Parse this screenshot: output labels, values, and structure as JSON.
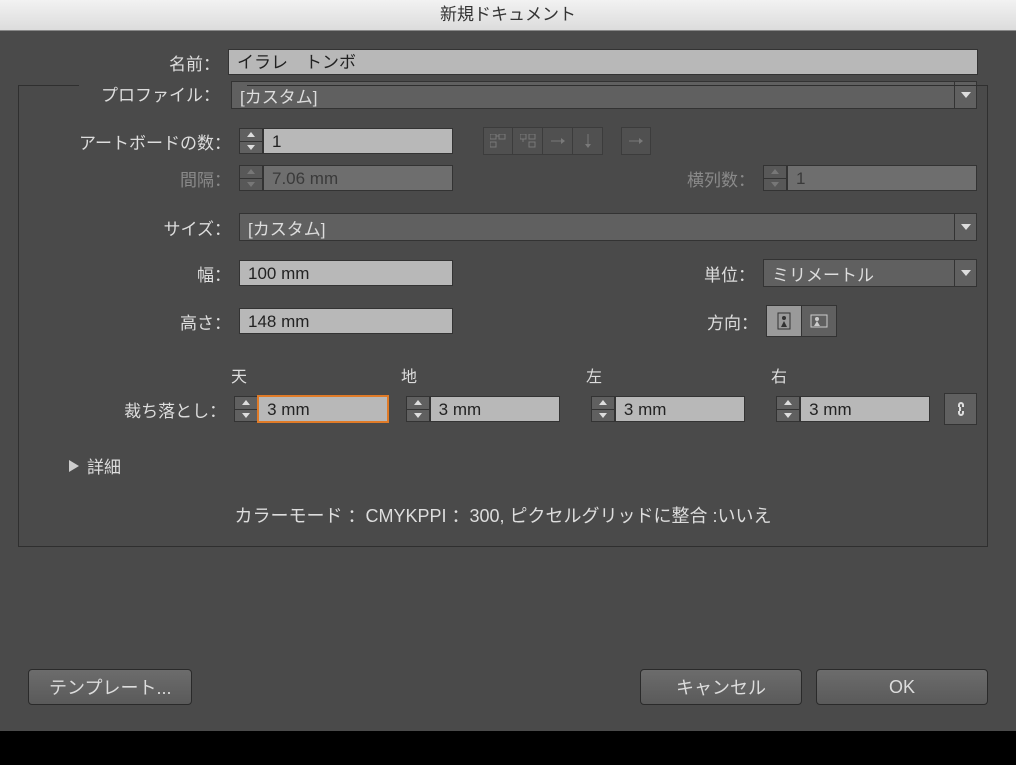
{
  "title": "新規ドキュメント",
  "name": {
    "label": "名前：",
    "value": "イラレ　トンボ"
  },
  "profile": {
    "label": "プロファイル：",
    "value": "[カスタム]"
  },
  "artboards": {
    "label": "アートボードの数：",
    "value": "1"
  },
  "spacing": {
    "label": "間隔：",
    "value": "7.06 mm"
  },
  "columns": {
    "label": "横列数：",
    "value": "1"
  },
  "size": {
    "label": "サイズ：",
    "value": "[カスタム]"
  },
  "width": {
    "label": "幅：",
    "value": "100 mm"
  },
  "height": {
    "label": "高さ：",
    "value": "148 mm"
  },
  "units": {
    "label": "単位：",
    "value": "ミリメートル"
  },
  "orientation": {
    "label": "方向："
  },
  "bleed": {
    "label": "裁ち落とし：",
    "top": {
      "label": "天",
      "value": "3 mm"
    },
    "bottom": {
      "label": "地",
      "value": "3 mm"
    },
    "left": {
      "label": "左",
      "value": "3 mm"
    },
    "right": {
      "label": "右",
      "value": "3 mm"
    }
  },
  "advanced": {
    "label": "詳細"
  },
  "summary": "カラーモード ：CMYKPPI ：300, ピクセルグリッドに整合 :いいえ",
  "buttons": {
    "template": "テンプレート...",
    "cancel": "キャンセル",
    "ok": "OK"
  }
}
